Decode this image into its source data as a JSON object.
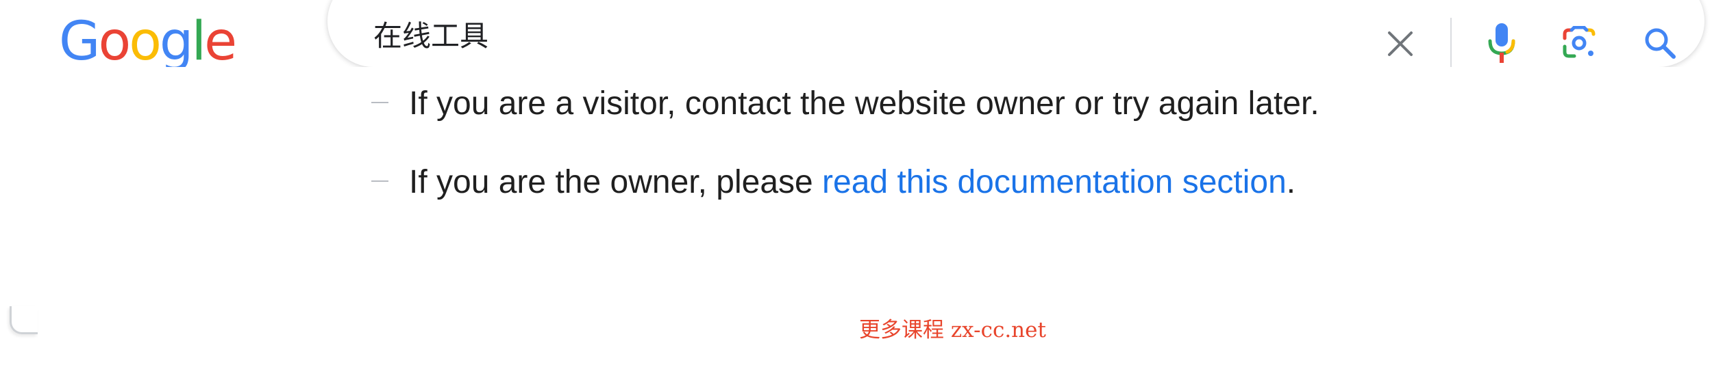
{
  "logo": {
    "letters": [
      "G",
      "o",
      "o",
      "g",
      "l",
      "e"
    ],
    "colors": [
      "#4285F4",
      "#EA4335",
      "#FBBC05",
      "#4285F4",
      "#34A853",
      "#EA4335"
    ]
  },
  "search": {
    "query": "在线工具",
    "icons": {
      "clear": "close-icon",
      "voice": "microphone-icon",
      "lens": "camera-lens-icon",
      "search": "search-icon"
    }
  },
  "message": {
    "item1": "If you are a visitor, contact the website owner or try again later.",
    "item2_prefix": "If you are the owner, please ",
    "item2_link": "read this documentation section",
    "item2_suffix": "."
  },
  "watermark": {
    "text": "更多课程 zx-cc.net"
  },
  "colors": {
    "link": "#1a73e8",
    "text": "#1f1f1f",
    "watermark": "#e8452c"
  }
}
